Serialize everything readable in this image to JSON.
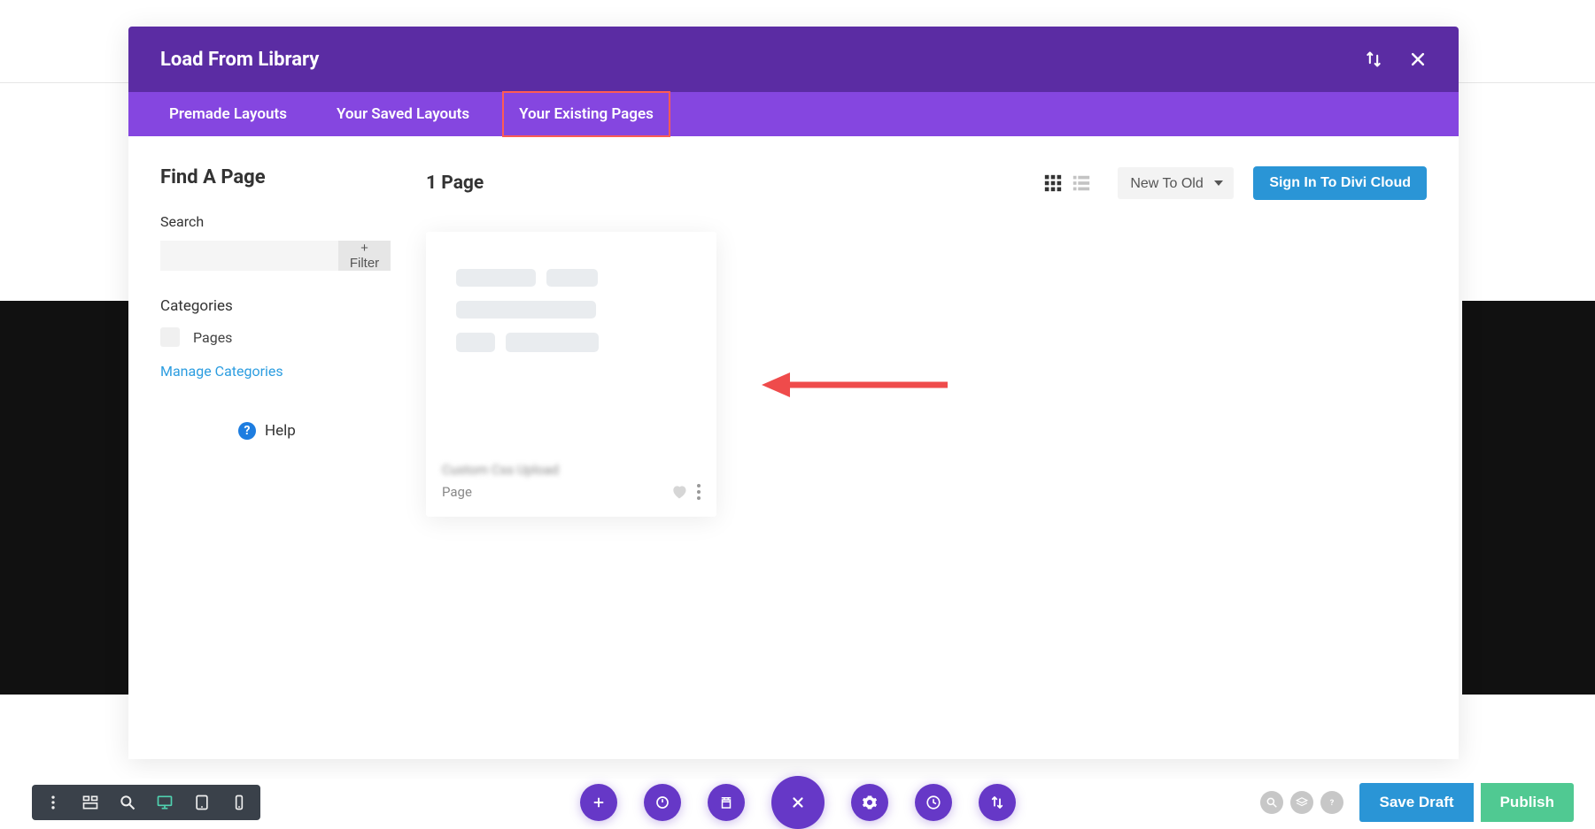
{
  "modal": {
    "title": "Load From Library",
    "tabs": [
      {
        "label": "Premade Layouts"
      },
      {
        "label": "Your Saved Layouts"
      },
      {
        "label": "Your Existing Pages"
      }
    ]
  },
  "sidebar": {
    "title": "Find A Page",
    "search_label": "Search",
    "search_placeholder": "",
    "filter_btn": "+ Filter",
    "categories_label": "Categories",
    "category_items": [
      {
        "name": "Pages"
      }
    ],
    "manage_link": "Manage Categories",
    "help": "Help"
  },
  "main": {
    "title": "1 Page",
    "sort_options": [
      "New To Old"
    ],
    "sort_value": "New To Old",
    "signin": "Sign In To Divi Cloud",
    "card": {
      "blur_title": "Custom Css Upload",
      "type": "Page"
    }
  },
  "bottom_bar": {
    "save_draft": "Save Draft",
    "publish": "Publish"
  }
}
